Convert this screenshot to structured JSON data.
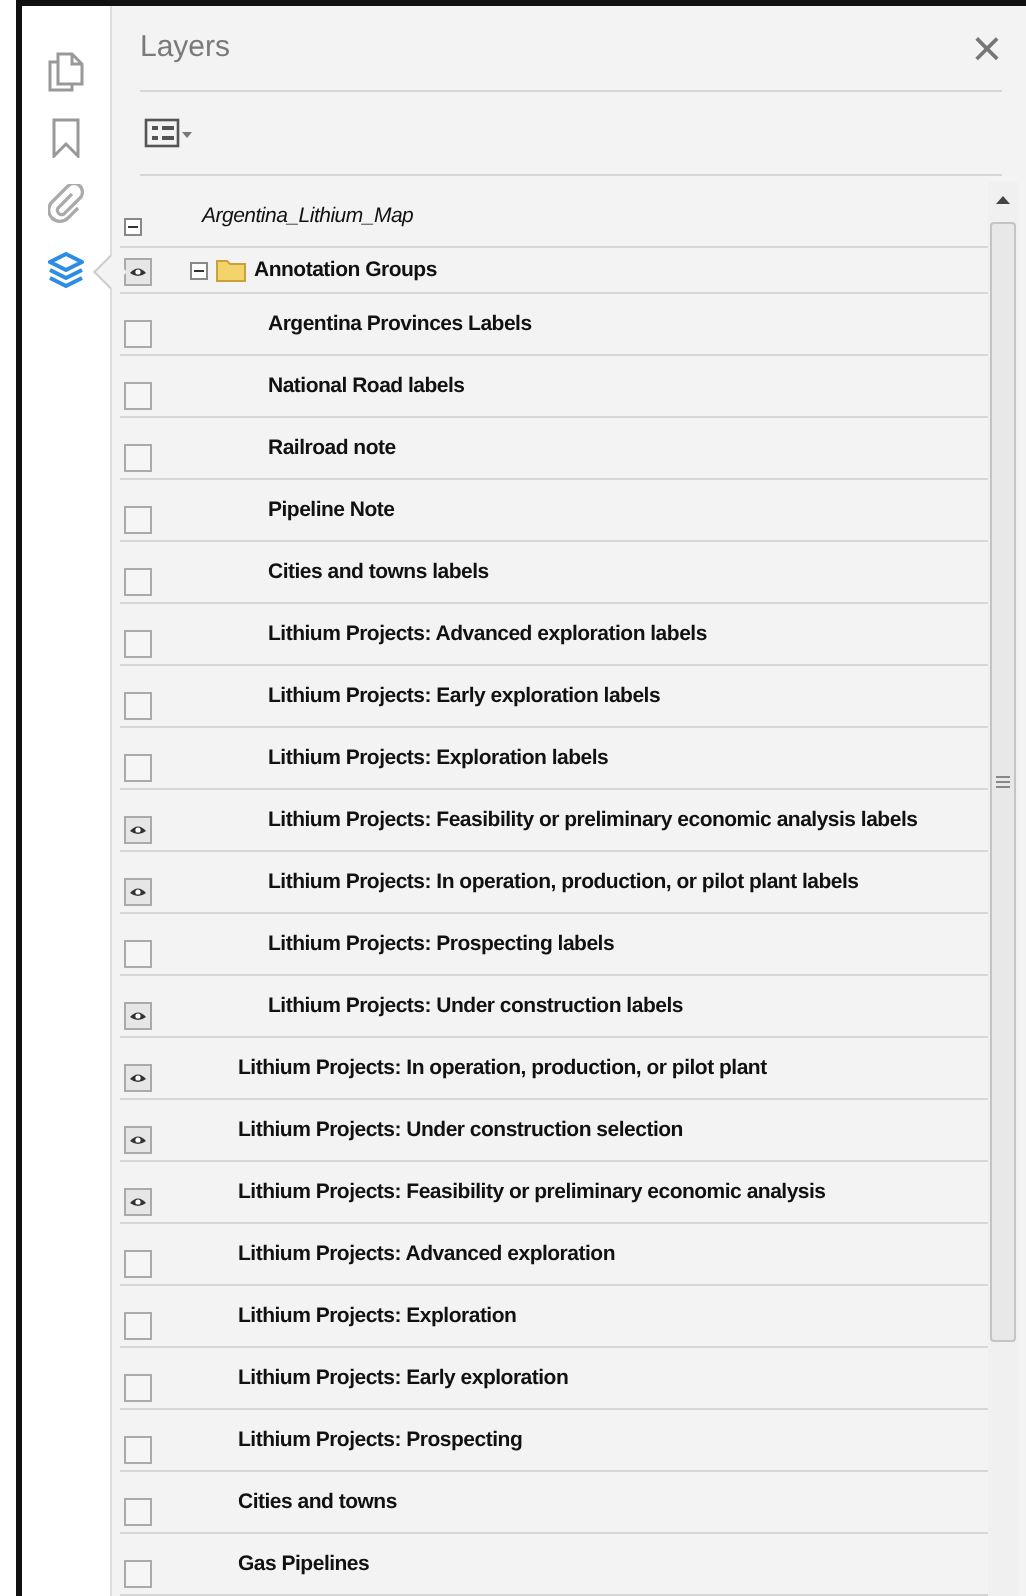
{
  "sidebar": {
    "items": [
      {
        "kind": "pages",
        "selected": false
      },
      {
        "kind": "bookmarks",
        "selected": false
      },
      {
        "kind": "attachments",
        "selected": false
      },
      {
        "kind": "layers",
        "selected": true
      }
    ]
  },
  "panel": {
    "title": "Layers",
    "close": "×"
  },
  "tree": {
    "label": "Argentina_Lithium_Map",
    "expanded": true,
    "children": [
      {
        "label": "Annotation Groups",
        "kind": "folder",
        "expanded": true,
        "visible": true,
        "children": [
          {
            "label": "Argentina Provinces Labels",
            "visible": false
          },
          {
            "label": "National Road labels",
            "visible": false
          },
          {
            "label": "Railroad note",
            "visible": false
          },
          {
            "label": "Pipeline Note",
            "visible": false
          },
          {
            "label": "Cities and towns labels",
            "visible": false
          },
          {
            "label": "Lithium Projects: Advanced exploration labels",
            "visible": false
          },
          {
            "label": "Lithium Projects: Early exploration labels",
            "visible": false
          },
          {
            "label": "Lithium Projects: Exploration labels",
            "visible": false
          },
          {
            "label": "Lithium Projects: Feasibility or preliminary economic analysis labels",
            "visible": true
          },
          {
            "label": "Lithium Projects: In operation, production, or pilot plant labels",
            "visible": true
          },
          {
            "label": "Lithium Projects: Prospecting labels",
            "visible": false
          },
          {
            "label": "Lithium Projects: Under construction labels",
            "visible": true
          }
        ]
      },
      {
        "label": "Lithium Projects: In operation, production, or pilot plant",
        "visible": true
      },
      {
        "label": "Lithium Projects: Under construction selection",
        "visible": true
      },
      {
        "label": "Lithium Projects: Feasibility or preliminary economic analysis",
        "visible": true
      },
      {
        "label": "Lithium Projects: Advanced exploration",
        "visible": false
      },
      {
        "label": "Lithium Projects: Exploration",
        "visible": false
      },
      {
        "label": "Lithium Projects: Early exploration",
        "visible": false
      },
      {
        "label": "Lithium Projects: Prospecting",
        "visible": false
      },
      {
        "label": "Cities and towns",
        "visible": false
      },
      {
        "label": "Gas Pipelines",
        "visible": false
      }
    ]
  }
}
